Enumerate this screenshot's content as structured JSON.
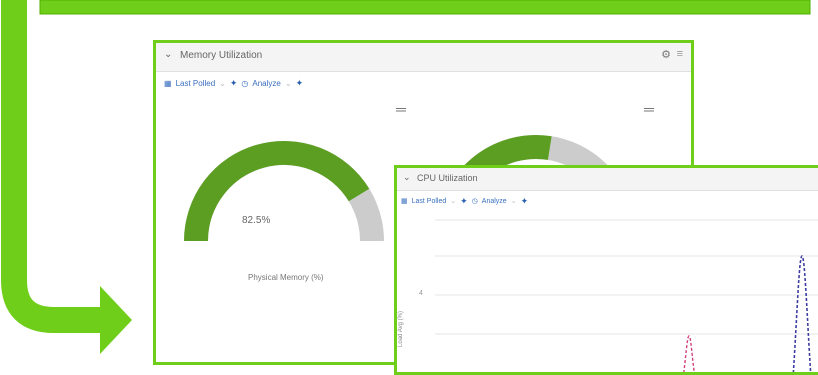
{
  "memory_panel": {
    "title": "Memory Utilization",
    "toolbar": {
      "last_polled": "Last Polled",
      "analyze": "Analyze"
    },
    "gauges": [
      {
        "value_text": "82.5%",
        "fraction": 0.825,
        "label": "Physical Memory (%)"
      },
      {
        "fraction": 0.55,
        "label": ""
      }
    ]
  },
  "cpu_panel": {
    "title": "CPU Utilization",
    "toolbar": {
      "last_polled": "Last Polled",
      "analyze": "Analyze"
    },
    "y_axis_label": "Load Avg (%)",
    "y_ticks": [
      "",
      "4",
      ""
    ]
  },
  "colors": {
    "accent_green": "#6fce1a",
    "gauge_green": "#5c9e22",
    "gauge_gray": "#cccccc",
    "spike_pink": "#d2407c",
    "spike_blue": "#3c3ca0"
  },
  "icons": [
    "chevron-down-icon",
    "calendar-icon",
    "pin-icon",
    "analyze-icon",
    "gear-icon",
    "menu-icon",
    "drag-handle-icon"
  ]
}
